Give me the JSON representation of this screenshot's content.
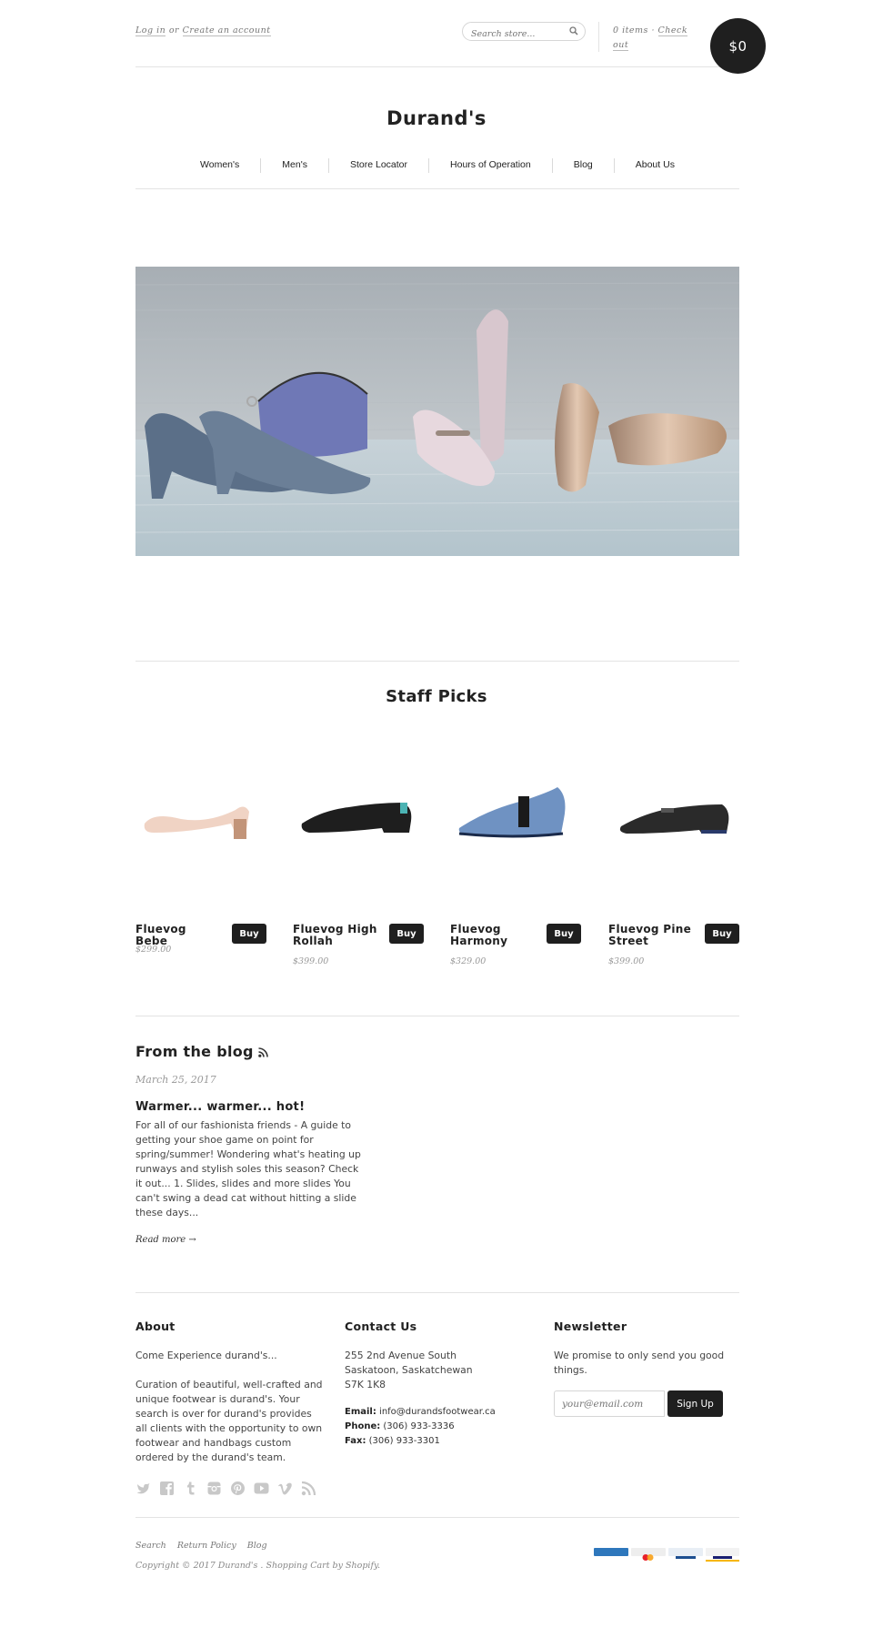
{
  "topbar": {
    "login": "Log in",
    "or": "or",
    "create_account": "Create an account",
    "search_placeholder": "Search store...",
    "cart_items": "0 items",
    "cart_sep": "·",
    "checkout": "Check out",
    "cart_total": "$0"
  },
  "store_name": "Durand's",
  "nav": [
    "Women's",
    "Men's",
    "Store Locator",
    "Hours of Operation",
    "Blog",
    "About Us"
  ],
  "staff_picks": {
    "title": "Staff Picks",
    "products": [
      {
        "name": "Fluevog Bebe",
        "price": "$299.00",
        "buy": "Buy"
      },
      {
        "name": "Fluevog High Rollah",
        "price": "$399.00",
        "buy": "Buy"
      },
      {
        "name": "Fluevog Harmony",
        "price": "$329.00",
        "buy": "Buy"
      },
      {
        "name": "Fluevog Pine Street",
        "price": "$399.00",
        "buy": "Buy"
      }
    ]
  },
  "blog": {
    "title": "From the blog",
    "date": "March 25, 2017",
    "post_title": "Warmer... warmer... hot!",
    "excerpt": "For all of our fashionista friends -   A guide to getting your shoe game on point for spring/summer! Wondering what's heating up runways and stylish soles this season? Check it out... 1. Slides, slides and more slides You can't swing a dead cat without hitting a slide these days...",
    "read_more": "Read more →"
  },
  "footer": {
    "about": {
      "title": "About",
      "line1": "Come Experience durand's...",
      "body": "Curation of beautiful, well-crafted and unique footwear is durand's. Your search is over for durand's provides all clients with the opportunity to own footwear and handbags custom ordered by the durand's team."
    },
    "contact": {
      "title": "Contact Us",
      "address1": "255 2nd Avenue South",
      "address2": "Saskatoon, Saskatchewan",
      "address3": "S7K 1K8",
      "email_label": "Email:",
      "email": "info@durandsfootwear.ca",
      "phone_label": "Phone:",
      "phone": "(306) 933-3336",
      "fax_label": "Fax:",
      "fax": "(306) 933-3301"
    },
    "newsletter": {
      "title": "Newsletter",
      "text": "We promise to only send you good things.",
      "placeholder": "your@email.com",
      "button": "Sign Up"
    },
    "social_icons": [
      "twitter-icon",
      "facebook-icon",
      "tumblr-icon",
      "instagram-icon",
      "pinterest-icon",
      "youtube-icon",
      "vimeo-icon",
      "rss-icon"
    ],
    "links": [
      "Search",
      "Return Policy",
      "Blog"
    ],
    "copyright": "Copyright © 2017 Durand's . Shopping Cart by Shopify.",
    "payment_icons": [
      "american-express-icon",
      "mastercard-icon",
      "paypal-icon",
      "visa-icon"
    ]
  },
  "colors": {
    "dark": "#1f1f1f",
    "divider": "#e3e3e3",
    "muted": "#999999"
  }
}
